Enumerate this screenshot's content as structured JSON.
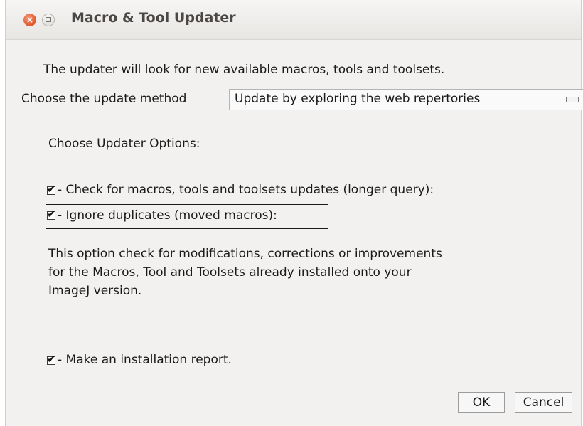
{
  "window": {
    "title": "Macro & Tool Updater"
  },
  "intro_text": "The updater will look for new available macros, tools and toolsets.",
  "method": {
    "label": "Choose the update method",
    "selected": "Update by exploring the web repertories"
  },
  "options_header": "Choose Updater Options:",
  "options": [
    {
      "label": "- Check for macros, tools and toolsets updates (longer query):",
      "checked": true
    },
    {
      "label": "- Ignore duplicates (moved macros):",
      "checked": true
    }
  ],
  "description": [
    "This option check for modifications, corrections or improvements",
    "for the Macros, Tool and Toolsets already installed onto your",
    "ImageJ version."
  ],
  "report_option": {
    "label": "- Make an installation report.",
    "checked": true
  },
  "buttons": {
    "ok": "OK",
    "cancel": "Cancel"
  },
  "icons": {
    "close": "close-icon",
    "maximize": "maximize-icon",
    "dropdown": "dropdown-arrow-icon",
    "check": "checkmark-icon"
  },
  "colors": {
    "close_button": "#e1572c",
    "window_bg": "#f2f1f0",
    "title_text": "#4a4744"
  }
}
